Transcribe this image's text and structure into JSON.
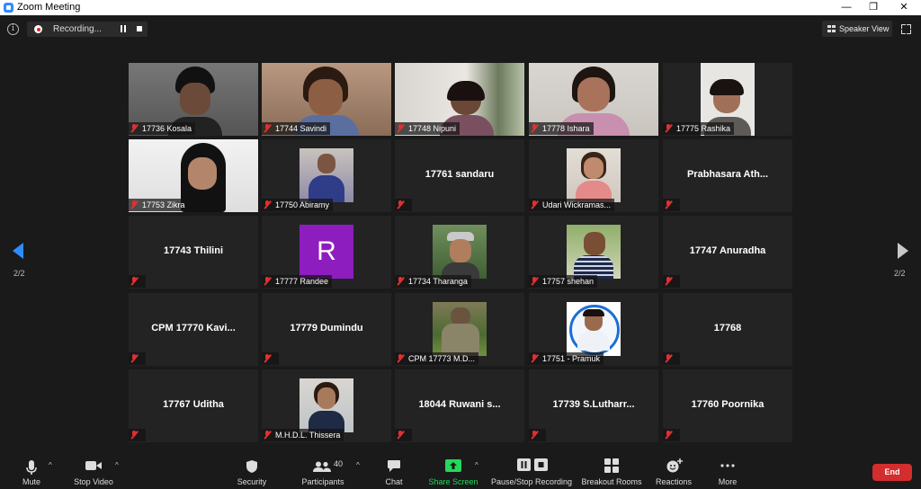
{
  "window": {
    "title": "Zoom Meeting",
    "minimize": "—",
    "maximize": "❐",
    "close": "✕"
  },
  "top": {
    "recording_label": "Recording...",
    "speaker_view_label": "Speaker View"
  },
  "pager": {
    "left": "2/2",
    "right": "2/2"
  },
  "tiles": [
    {
      "label": "17736 Kosala"
    },
    {
      "label": "17744 Savindi"
    },
    {
      "label": "17748 Nipuni"
    },
    {
      "label": "17778 Ishara"
    },
    {
      "label": "17775 Rashika"
    },
    {
      "label": "17753 Zikra"
    },
    {
      "label": "17750 Abiramy"
    },
    {
      "center": "17761 sandaru"
    },
    {
      "label": "Udari Wickramas..."
    },
    {
      "center": "Prabhasara  Ath..."
    },
    {
      "center": "17743 Thilini"
    },
    {
      "label": "17777 Randee",
      "avatar_letter": "R"
    },
    {
      "label": "17734 Tharanga"
    },
    {
      "label": "17757 shehan"
    },
    {
      "center": "17747 Anuradha"
    },
    {
      "center": "CPM 17770  Kavi..."
    },
    {
      "center": "17779 Dumindu"
    },
    {
      "label": "CPM 17773 M.D..."
    },
    {
      "label": "17751 - Pramuk"
    },
    {
      "center": "17768"
    },
    {
      "center": "17767 Uditha"
    },
    {
      "label": "M.H.D.L. Thissera"
    },
    {
      "center": "18044 Ruwani s..."
    },
    {
      "center": "17739  S.Lutharr..."
    },
    {
      "center": "17760  Poornika"
    }
  ],
  "toolbar": {
    "mute": "Mute",
    "stop_video": "Stop Video",
    "security": "Security",
    "participants": "Participants",
    "participants_count": "40",
    "chat": "Chat",
    "share_screen": "Share Screen",
    "pause_recording": "Pause/Stop Recording",
    "breakout_rooms": "Breakout Rooms",
    "reactions": "Reactions",
    "more": "More",
    "end": "End"
  },
  "colors": {
    "share_green": "#23d959",
    "end_red": "#d42d2d",
    "accent_blue": "#2d8cff"
  }
}
